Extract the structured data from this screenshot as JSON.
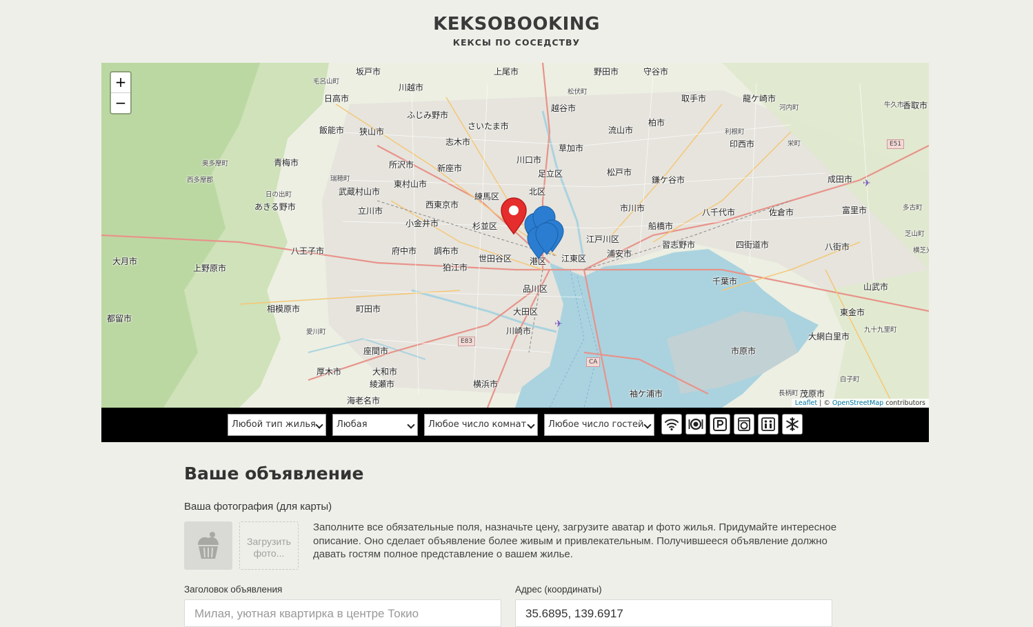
{
  "header": {
    "title": "KEKSOBOOKING",
    "subtitle": "КЕКСЫ ПО СОСЕДСТВУ"
  },
  "map": {
    "zoom_in": "+",
    "zoom_out": "−",
    "attribution_leaflet": "Leaflet",
    "attribution_sep": " | © ",
    "attribution_osm": "OpenStreetMap",
    "attribution_contrib": " contributors",
    "labels": [
      "坂戸市",
      "上尾市",
      "野田市",
      "守谷市",
      "毛呂山町",
      "川越市",
      "松伏町",
      "日高市",
      "取手市",
      "龍ケ崎市",
      "ふじみ野市",
      "越谷市",
      "牛久市",
      "さいたま市",
      "河内町",
      "香取市",
      "飯能市",
      "狭山市",
      "流山市",
      "柏市",
      "志木市",
      "利根町",
      "草加市",
      "印西市",
      "栄町",
      "奥多摩町",
      "青梅市",
      "川口市",
      "所沢市",
      "新座市",
      "足立区",
      "松戸市",
      "鎌ケ谷市",
      "成田市",
      "西多摩郡",
      "瑞穂町",
      "東村山市",
      "日の出町",
      "武蔵村山市",
      "北区",
      "練馬区",
      "西東京市",
      "市川市",
      "八千代市",
      "佐倉市",
      "富里市",
      "多古町",
      "あきる野市",
      "立川市",
      "小金井市",
      "杉並区",
      "船橋市",
      "芝山町",
      "江戸川区",
      "習志野市",
      "四街道市",
      "八街市",
      "横芝光町",
      "八王子市",
      "府中市",
      "調布市",
      "大月市",
      "世田谷区",
      "江東区",
      "浦安市",
      "狛江市",
      "港区",
      "上野原市",
      "千葉市",
      "山武市",
      "品川区",
      "相模原市",
      "都留市",
      "大田区",
      "町田市",
      "東金市",
      "愛川町",
      "川崎市",
      "九十九里町",
      "大網白里市",
      "座間市",
      "市原市",
      "厚木市",
      "大和市",
      "綾瀬市",
      "横浜市",
      "白子町",
      "海老名市",
      "袖ケ浦市",
      "長柄町",
      "茂原市"
    ],
    "shields": [
      "E51",
      "E83",
      "CA"
    ]
  },
  "filters": {
    "housing_type": "Любой тип жилья",
    "price": "Любая",
    "rooms": "Любое число комнат",
    "guests": "Любое число гостей",
    "features": [
      "wifi-icon",
      "dishwasher-icon",
      "parking-icon",
      "washer-icon",
      "elevator-icon",
      "conditioner-icon"
    ]
  },
  "form": {
    "title": "Ваше объявление",
    "photo_label": "Ваша фотография (для карты)",
    "upload_label": "Загрузить фото...",
    "hint": "Заполните все обязательные поля, назначьте цену, загрузите аватар и фото жилья. Придумайте интересное описание. Оно сделает объявление более живым и привлекательным. Получившееся объявление должно давать гостям полное представление о вашем жилье.",
    "title_field_label": "Заголовок объявления",
    "title_field_placeholder": "Милая, уютная квартирка в центре Токио",
    "address_label": "Адрес (координаты)",
    "address_value": "35.6895, 139.6917"
  },
  "colors": {
    "background": "#efefea",
    "main_pin": "#e52d2d",
    "offer_pin": "#2b7dd1",
    "water": "#aad3df",
    "land": "#e9eedd",
    "forest": "#c8dfb0"
  }
}
